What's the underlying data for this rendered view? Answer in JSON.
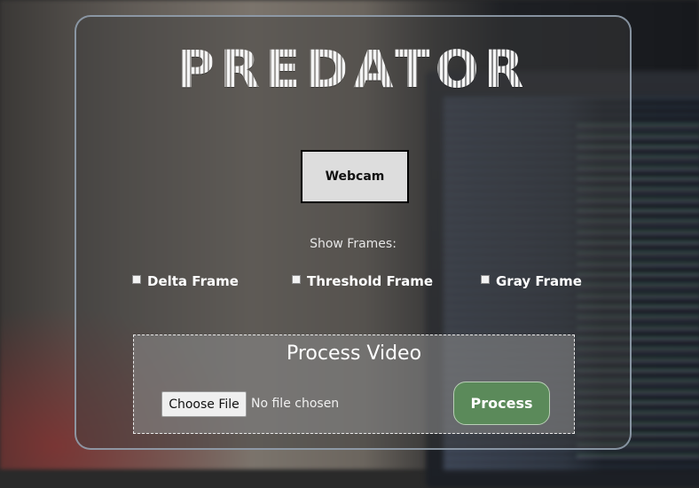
{
  "app": {
    "title": "PREDATOR"
  },
  "controls": {
    "webcam_label": "Webcam",
    "show_frames_label": "Show Frames:",
    "checkboxes": [
      {
        "label": "Delta Frame",
        "checked": false
      },
      {
        "label": "Threshold Frame",
        "checked": false
      },
      {
        "label": "Gray Frame",
        "checked": false
      }
    ]
  },
  "process": {
    "title": "Process Video",
    "choose_file_label": "Choose File",
    "file_status": "No file chosen",
    "process_label": "Process"
  },
  "colors": {
    "process_button": "#5b8a5a",
    "panel_border": "#96a5b4",
    "webcam_button": "#dddddd"
  }
}
